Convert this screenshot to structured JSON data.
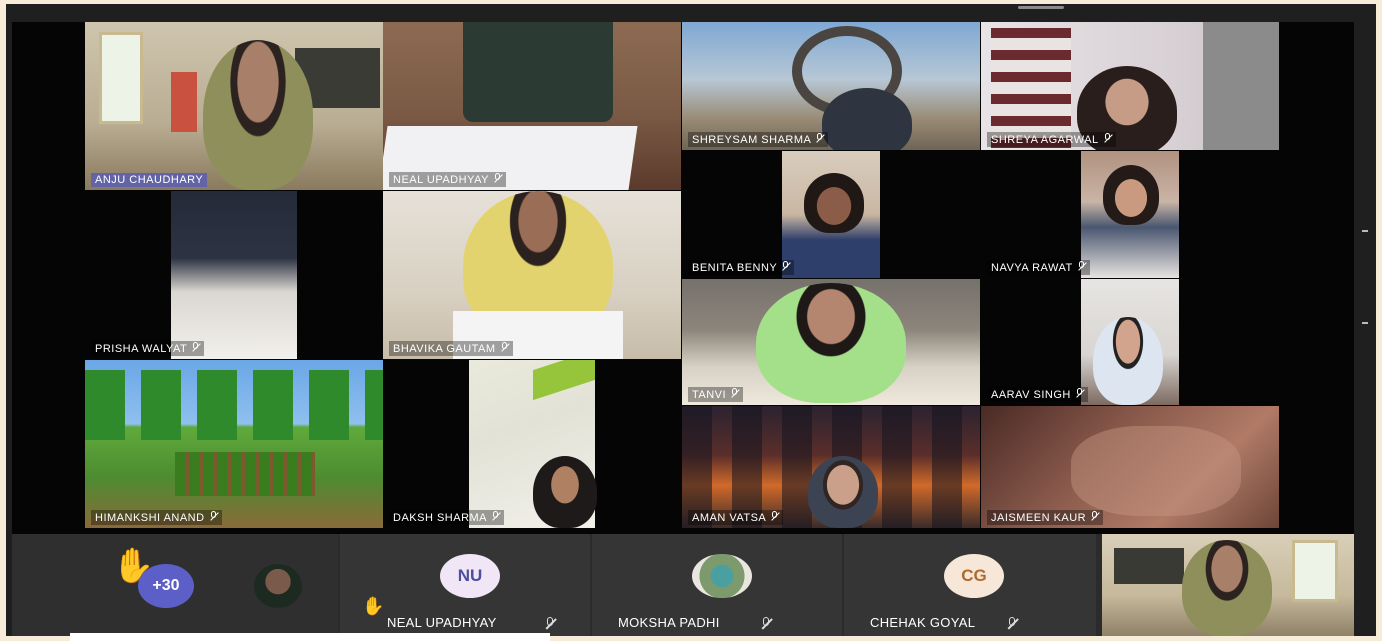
{
  "meeting": {
    "participants": [
      {
        "name": "ANJU  CHAUDHARY"
      },
      {
        "name": "NEAL  UPADHYAY"
      },
      {
        "name": "SHREYSAM  SHARMA"
      },
      {
        "name": "SHREYA  AGARWAL"
      },
      {
        "name": "PRISHA  WALYAT"
      },
      {
        "name": "BHAVIKA  GAUTAM"
      },
      {
        "name": "BENITA  BENNY"
      },
      {
        "name": "NAVYA  RAWAT"
      },
      {
        "name": "TANVI"
      },
      {
        "name": "AARAV  SINGH"
      },
      {
        "name": "HIMANKSHI  ANAND"
      },
      {
        "name": "DAKSH  SHARMA"
      },
      {
        "name": "AMAN  VATSA"
      },
      {
        "name": "JAISMEEN  KAUR"
      }
    ]
  },
  "bottom_bar": {
    "overflow_count": "+30",
    "raised_hand_icon": "raised-hand-icon",
    "participants": [
      {
        "initials": "NU",
        "name": "NEAL UPADHYAY"
      },
      {
        "initials": "",
        "name": "MOKSHA PADHI"
      },
      {
        "initials": "CG",
        "name": "CHEHAK GOYAL"
      }
    ]
  },
  "colors": {
    "accent": "#6264a7",
    "overflow_badge": "#5b5fc7",
    "initials_bg": "#f0e6f6",
    "cg_bg": "#f6e7d9",
    "page_bg": "#f7ecd8"
  }
}
